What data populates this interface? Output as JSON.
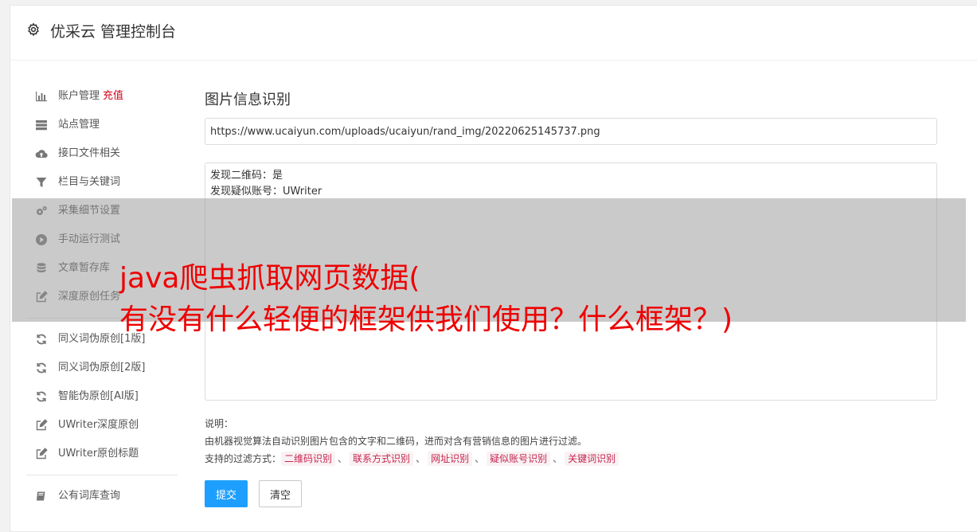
{
  "header": {
    "title": "优采云 管理控制台",
    "icon": "gear-icon"
  },
  "sidebar": {
    "items": [
      {
        "label": "账户管理",
        "badge": "充值",
        "icon": "bar-chart-icon"
      },
      {
        "label": "站点管理",
        "icon": "server-icon"
      },
      {
        "label": "接口文件相关",
        "icon": "cloud-upload-icon"
      },
      {
        "label": "栏目与关键词",
        "icon": "filter-icon"
      },
      {
        "label": "采集细节设置",
        "icon": "gears-icon"
      },
      {
        "label": "手动运行测试",
        "icon": "play-circle-icon"
      },
      {
        "label": "文章暂存库",
        "icon": "database-icon"
      },
      {
        "label": "深度原创任务",
        "icon": "edit-icon"
      },
      {
        "label": "同义词伪原创[1版]",
        "icon": "refresh-icon"
      },
      {
        "label": "同义词伪原创[2版]",
        "icon": "refresh-icon"
      },
      {
        "label": "智能伪原创[AI版]",
        "icon": "refresh-icon"
      },
      {
        "label": "UWriter深度原创",
        "icon": "edit-icon"
      },
      {
        "label": "UWriter原创标题",
        "icon": "edit-icon"
      },
      {
        "label": "公有词库查询",
        "icon": "book-icon"
      }
    ]
  },
  "main": {
    "title": "图片信息识别",
    "url_value": "https://www.ucaiyun.com/uploads/ucaiyun/rand_img/20220625145737.png",
    "result_lines": [
      "发现二维码：是",
      "发现疑似账号：UWriter"
    ],
    "desc_label": "说明：",
    "desc_text": "由机器视觉算法自动识别图片包含的文字和二维码，进而对含有营销信息的图片进行过滤。",
    "filter_label": "支持的过滤方式：",
    "filters": [
      "二维码识别",
      "联系方式识别",
      "网址识别",
      "疑似账号识别",
      "关键词识别"
    ],
    "filter_separator": "、",
    "submit_label": "提交",
    "clear_label": "清空"
  },
  "overlay": {
    "line1": "java爬虫抓取网页数据(",
    "line2": "有没有什么轻便的框架供我们使用？什么框架？)"
  },
  "colors": {
    "primary": "#1e9fff",
    "accent_red": "#d0021b",
    "overlay_text": "#ee0000",
    "tag_text": "#c7254e",
    "tag_bg": "#f9f2f4"
  }
}
